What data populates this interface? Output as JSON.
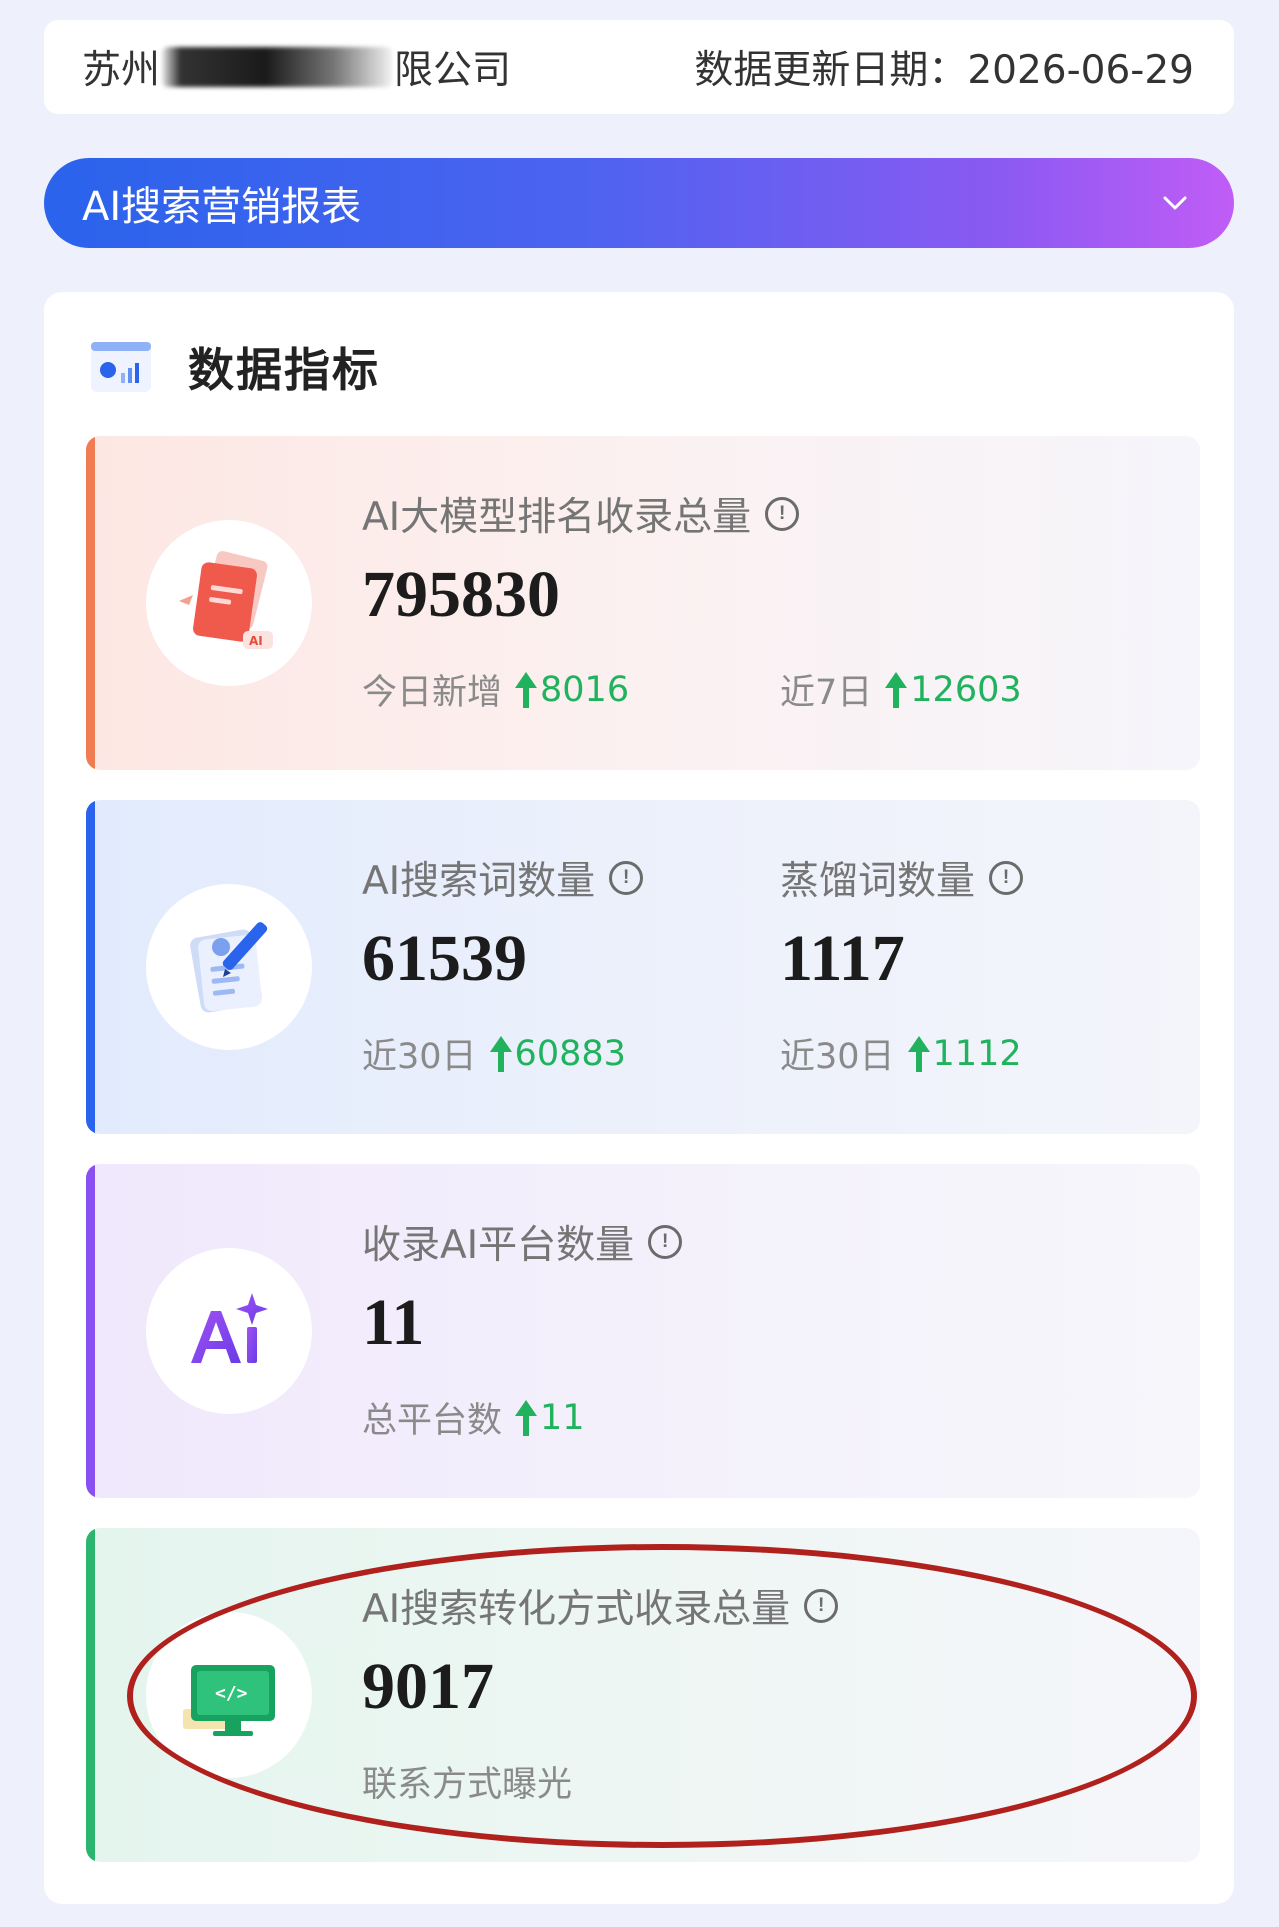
{
  "header": {
    "company_prefix": "苏州",
    "company_suffix": "限公司",
    "update_label": "数据更新日期：",
    "update_date": "2026-06-29"
  },
  "report_selector": {
    "label": "AI搜索营销报表"
  },
  "panel": {
    "title": "数据指标"
  },
  "cards": [
    {
      "label": "AI大模型排名收录总量",
      "value": "795830",
      "sub": [
        {
          "label": "今日新增",
          "delta": "8016"
        },
        {
          "label": "近7日",
          "delta": "12603"
        }
      ]
    },
    {
      "metrics": [
        {
          "label": "AI搜索词数量",
          "value": "61539",
          "sub_label": "近30日",
          "delta": "60883"
        },
        {
          "label": "蒸馏词数量",
          "value": "1117",
          "sub_label": "近30日",
          "delta": "1112"
        }
      ]
    },
    {
      "label": "收录AI平台数量",
      "value": "11",
      "sub": [
        {
          "label": "总平台数",
          "delta": "11"
        }
      ]
    },
    {
      "label": "AI搜索转化方式收录总量",
      "value": "9017",
      "sub_text": "联系方式曝光"
    }
  ],
  "colors": {
    "accent_blue": "#2a63ec",
    "accent_purple": "#c05df6",
    "up_green": "#21b25d",
    "annotation_red": "#b0201c"
  }
}
